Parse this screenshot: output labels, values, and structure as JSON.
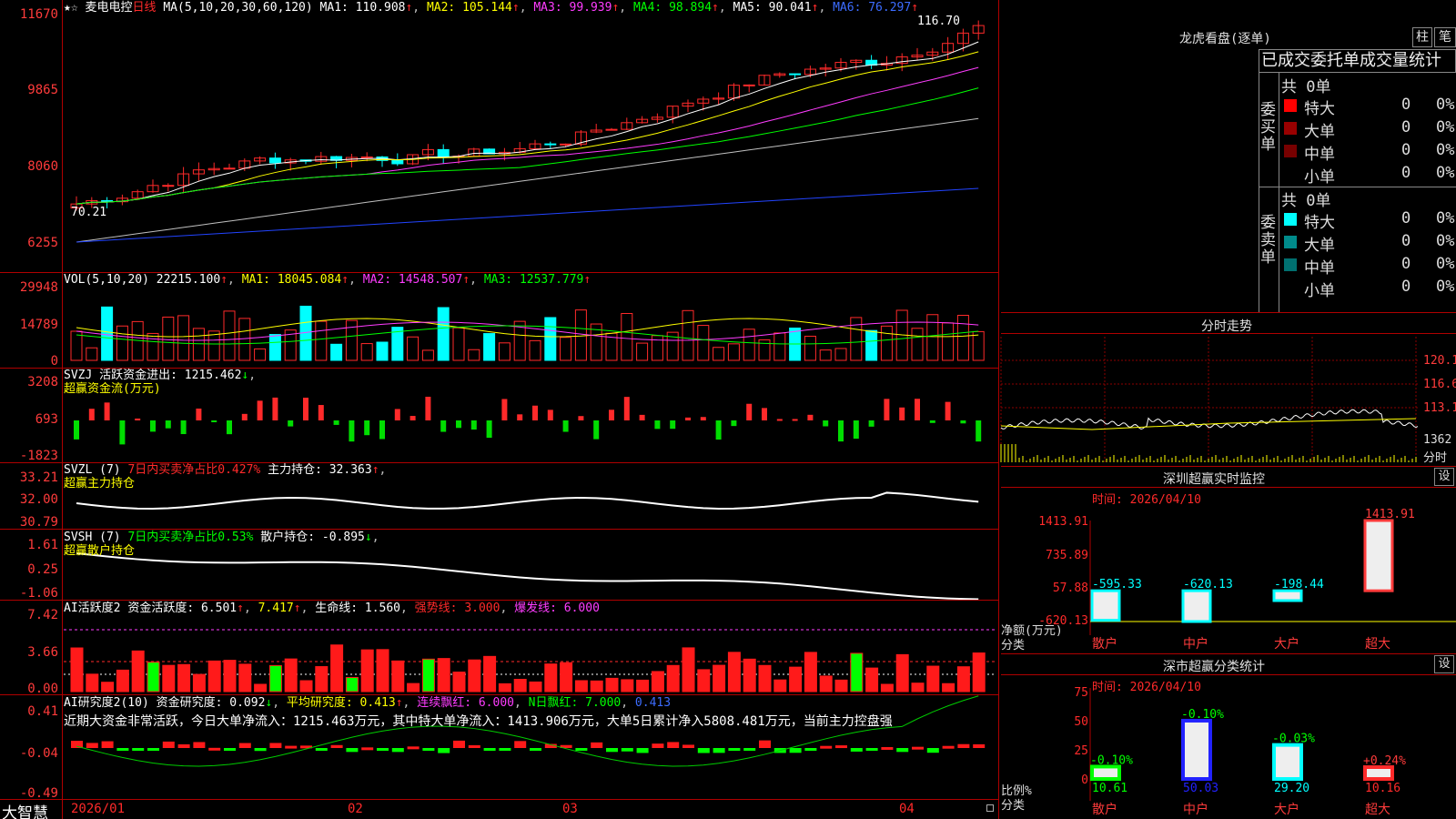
{
  "stock": {
    "icons": "★☆",
    "name": "麦电电控",
    "period": "日线"
  },
  "ma": {
    "head": "MA(5,10,20,30,60,120)",
    "ma1": "MA1: 110.908",
    "ma2": "MA2: 105.144",
    "ma3": "MA3: 99.939",
    "ma4": "MA4: 98.894",
    "ma5": "MA5: 90.041",
    "ma6": "MA6: 76.297",
    "arrow": "↑"
  },
  "price_axis": [
    "11670",
    "9865",
    "8060",
    "6255"
  ],
  "price_marks": {
    "high": "116.70",
    "low": "70.21"
  },
  "vol": {
    "head": "VOL(5,10,20)",
    "v": "22215.100",
    "ma1": "MA1: 18045.084",
    "ma2": "MA2: 14548.507",
    "ma3": "MA3: 12537.779",
    "axis": [
      "29948",
      "14789",
      "0"
    ]
  },
  "svzj": {
    "head": "SVZJ  活跃资金进出: 1215.462",
    "sub": "超赢资金流(万元)",
    "axis": [
      "3208",
      "693",
      "-1823"
    ]
  },
  "svzl": {
    "head": "SVZL (7)",
    "pct": "7日内买卖净占比0.427%",
    "hold": "主力持仓: 32.363",
    "sub": "超赢主力持仓",
    "axis": [
      "33.21",
      "32.00",
      "30.79"
    ]
  },
  "svsh": {
    "head": "SVSH (7)",
    "pct": "7日内买卖净占比0.53%",
    "hold": "散户持仓: -0.895",
    "sub": "超赢散户持仓",
    "axis": [
      "1.61",
      "0.25",
      "-1.06"
    ]
  },
  "ai1": {
    "head": "AI活跃度2",
    "a": "资金活跃度: 6.501",
    "b": "7.417",
    "c": "生命线: 1.560",
    "d": "强势线: 3.000",
    "e": "爆发线: 6.000",
    "axis": [
      "7.42",
      "3.66",
      "0.00"
    ]
  },
  "ai2": {
    "head": "AI研究度2(10)",
    "a": "资金研究度: 0.092",
    "b": "平均研究度: 0.413",
    "c": "连续飘红: 6.000",
    "d": "N日飘红: 7.000",
    "e": "0.413",
    "axis": [
      "0.41",
      "-0.04",
      "-0.49"
    ],
    "note": "近期大资金非常活跃，今日大单净流入：1215.463万元，其中特大单净流入：1413.906万元，大单5日累计净入5808.481万元，当前主力控盘强"
  },
  "xaxis": {
    "logo": "大智慧",
    "labels": [
      "2026/01",
      "02",
      "03",
      "04"
    ]
  },
  "lhb": {
    "title": "龙虎看盘(逐单)",
    "btn1": "柱",
    "btn2": "笔",
    "tabs": "已成交委托单成交量统计",
    "buy": {
      "side": "委买单",
      "total": "共 0单",
      "rows": [
        {
          "n": "特大",
          "v": "0",
          "p": "0%",
          "c": "#ff0000"
        },
        {
          "n": "大单",
          "v": "0",
          "p": "0%",
          "c": "#990000"
        },
        {
          "n": "中单",
          "v": "0",
          "p": "0%",
          "c": "#770000"
        },
        {
          "n": "小单",
          "v": "0",
          "p": "0%",
          "c": "#000000"
        }
      ]
    },
    "sell": {
      "side": "委卖单",
      "total": "共 0单",
      "rows": [
        {
          "n": "特大",
          "v": "0",
          "p": "0%",
          "c": "#00ffff"
        },
        {
          "n": "大单",
          "v": "0",
          "p": "0%",
          "c": "#008b8b"
        },
        {
          "n": "中单",
          "v": "0",
          "p": "0%",
          "c": "#007070"
        },
        {
          "n": "小单",
          "v": "0",
          "p": "0%",
          "c": "#000000"
        }
      ]
    }
  },
  "fs": {
    "title": "分时走势",
    "axis": [
      "120.1",
      "116.6",
      "113.1",
      "1362"
    ],
    "unit": "分时"
  },
  "szjk": {
    "title": "深圳超赢实时监控",
    "btn": "设",
    "time": "时间: 2026/04/10",
    "axis": [
      "1413.91",
      "735.89",
      "57.88",
      "-620.13"
    ],
    "ylabel1": "净额(万元)",
    "ylabel2": "分类",
    "chart_data": {
      "type": "bar",
      "categories": [
        "散户",
        "中户",
        "大户",
        "超大"
      ],
      "values": [
        -595.33,
        -620.13,
        -198.44,
        1413.91
      ],
      "labels": [
        "-595.33",
        "-620.13",
        "-198.44",
        "1413.91"
      ],
      "ylim": [
        -620.13,
        1413.91
      ]
    }
  },
  "ssfl": {
    "title": "深市超赢分类统计",
    "btn": "设",
    "time": "时间: 2026/04/10",
    "axis": [
      "75",
      "50",
      "25",
      "0"
    ],
    "ylabel1": "比例%",
    "ylabel2": "分类",
    "chart_data": {
      "type": "bar",
      "categories": [
        "散户",
        "中户",
        "大户",
        "超大"
      ],
      "values": [
        10.61,
        50.03,
        29.2,
        10.16
      ],
      "changes": [
        "-0.10%",
        "-0.10%",
        "-0.03%",
        "+0.24%"
      ],
      "vlabels": [
        "10.61",
        "50.03",
        "29.20",
        "10.16"
      ],
      "ylim": [
        0,
        75
      ]
    }
  }
}
